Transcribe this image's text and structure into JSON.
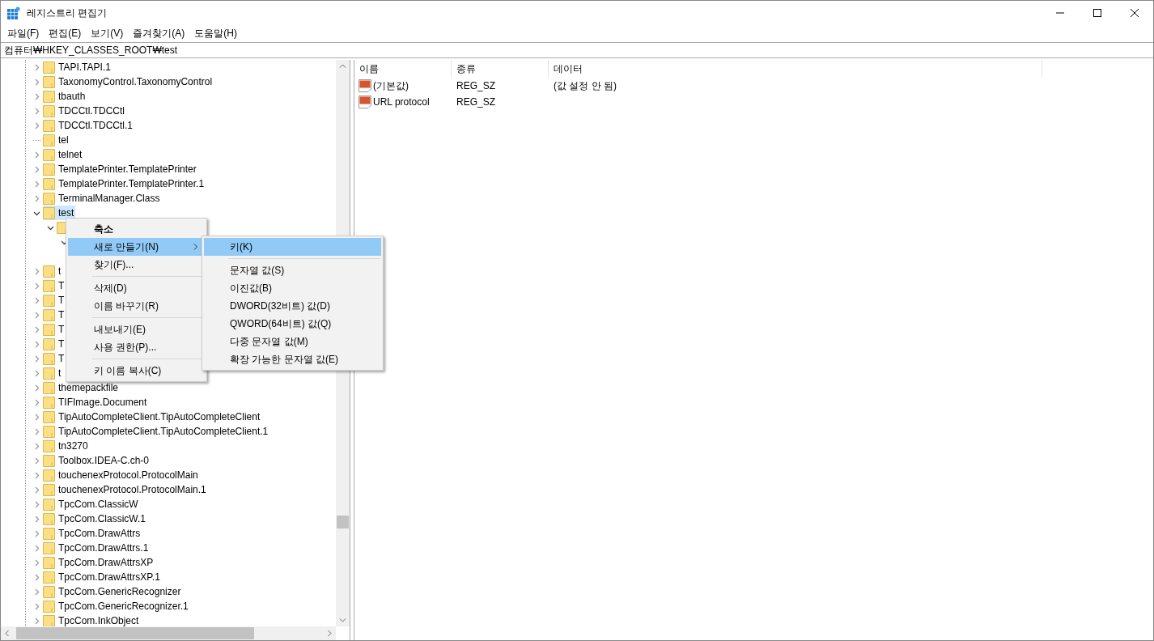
{
  "window": {
    "title": "레지스트리 편집기"
  },
  "menu_bar": [
    "파일(F)",
    "편집(E)",
    "보기(V)",
    "즐겨찾기(A)",
    "도움말(H)"
  ],
  "address": "컴퓨터₩HKEY_CLASSES_ROOT₩test",
  "tree": [
    {
      "label": "TAPI.TAPI.1",
      "kind": "key",
      "expanded": false,
      "selected": false
    },
    {
      "label": "TaxonomyControl.TaxonomyControl",
      "kind": "key",
      "expanded": false,
      "selected": false
    },
    {
      "label": "tbauth",
      "kind": "key",
      "expanded": false,
      "selected": false
    },
    {
      "label": "TDCCtl.TDCCtl",
      "kind": "key",
      "expanded": false,
      "selected": false
    },
    {
      "label": "TDCCtl.TDCCtl.1",
      "kind": "key",
      "expanded": false,
      "selected": false
    },
    {
      "label": "tel",
      "kind": "leaf",
      "selected": false
    },
    {
      "label": "telnet",
      "kind": "key",
      "expanded": false,
      "selected": false
    },
    {
      "label": "TemplatePrinter.TemplatePrinter",
      "kind": "key",
      "expanded": false,
      "selected": false
    },
    {
      "label": "TemplatePrinter.TemplatePrinter.1",
      "kind": "key",
      "expanded": false,
      "selected": false
    },
    {
      "label": "TerminalManager.Class",
      "kind": "key",
      "expanded": false,
      "selected": false
    },
    {
      "label": "test",
      "kind": "key",
      "expanded": true,
      "selected": true,
      "children": [
        {
          "kind": "key",
          "expanded": true,
          "selected": false,
          "children": [
            {
              "expanded": true
            }
          ]
        }
      ]
    },
    {
      "label": "t",
      "kind": "key",
      "expanded": false,
      "selected": false
    },
    {
      "label": "T",
      "kind": "key",
      "expanded": false,
      "selected": false
    },
    {
      "label": "T",
      "kind": "key",
      "expanded": false,
      "selected": false
    },
    {
      "label": "T",
      "kind": "key",
      "expanded": false,
      "selected": false
    },
    {
      "label": "T",
      "kind": "key",
      "expanded": false,
      "selected": false
    },
    {
      "label": "T",
      "kind": "key",
      "expanded": false,
      "selected": false
    },
    {
      "label": "T",
      "kind": "key",
      "expanded": false,
      "selected": false
    },
    {
      "label": "t",
      "kind": "key",
      "expanded": false,
      "selected": false
    },
    {
      "label": "themepackfile",
      "kind": "key",
      "expanded": false,
      "selected": false
    },
    {
      "label": "TIFImage.Document",
      "kind": "key",
      "expanded": false,
      "selected": false
    },
    {
      "label": "TipAutoCompleteClient.TipAutoCompleteClient",
      "kind": "key",
      "expanded": false,
      "selected": false
    },
    {
      "label": "TipAutoCompleteClient.TipAutoCompleteClient.1",
      "kind": "key",
      "expanded": false,
      "selected": false
    },
    {
      "label": "tn3270",
      "kind": "key",
      "expanded": false,
      "selected": false
    },
    {
      "label": "Toolbox.IDEA-C.ch-0",
      "kind": "key",
      "expanded": false,
      "selected": false
    },
    {
      "label": "touchenexProtocol.ProtocolMain",
      "kind": "key",
      "expanded": false,
      "selected": false
    },
    {
      "label": "touchenexProtocol.ProtocolMain.1",
      "kind": "key",
      "expanded": false,
      "selected": false
    },
    {
      "label": "TpcCom.ClassicW",
      "kind": "key",
      "expanded": false,
      "selected": false
    },
    {
      "label": "TpcCom.ClassicW.1",
      "kind": "key",
      "expanded": false,
      "selected": false
    },
    {
      "label": "TpcCom.DrawAttrs",
      "kind": "key",
      "expanded": false,
      "selected": false
    },
    {
      "label": "TpcCom.DrawAttrs.1",
      "kind": "key",
      "expanded": false,
      "selected": false
    },
    {
      "label": "TpcCom.DrawAttrsXP",
      "kind": "key",
      "expanded": false,
      "selected": false
    },
    {
      "label": "TpcCom.DrawAttrsXP.1",
      "kind": "key",
      "expanded": false,
      "selected": false
    },
    {
      "label": "TpcCom.GenericRecognizer",
      "kind": "key",
      "expanded": false,
      "selected": false
    },
    {
      "label": "TpcCom.GenericRecognizer.1",
      "kind": "key",
      "expanded": false,
      "selected": false
    },
    {
      "label": "TpcCom.InkObject",
      "kind": "key",
      "expanded": false,
      "selected": false
    }
  ],
  "values_table": {
    "columns": [
      "이름",
      "종류",
      "데이터"
    ],
    "rows": [
      {
        "name": "(기본값)",
        "type": "REG_SZ",
        "data": "(값 설정 안 됨)"
      },
      {
        "name": "URL protocol",
        "type": "REG_SZ"
      }
    ]
  },
  "context_menu": {
    "items": [
      {
        "kind": "item",
        "label": "축소",
        "bold": true,
        "selected": false,
        "submenu": false
      },
      {
        "kind": "item",
        "label": "새로 만들기(N)",
        "bold": false,
        "selected": true,
        "submenu": true
      },
      {
        "kind": "item",
        "label": "찾기(F)...",
        "bold": false,
        "selected": false,
        "submenu": false
      },
      {
        "kind": "separator"
      },
      {
        "kind": "item",
        "label": "삭제(D)",
        "bold": false,
        "selected": false,
        "submenu": false
      },
      {
        "kind": "item",
        "label": "이름 바꾸기(R)",
        "bold": false,
        "selected": false,
        "submenu": false
      },
      {
        "kind": "separator"
      },
      {
        "kind": "item",
        "label": "내보내기(E)",
        "bold": false,
        "selected": false,
        "submenu": false
      },
      {
        "kind": "item",
        "label": "사용 권한(P)...",
        "bold": false,
        "selected": false,
        "submenu": false
      },
      {
        "kind": "separator"
      },
      {
        "kind": "item",
        "label": "키 이름 복사(C)",
        "bold": false,
        "selected": false,
        "submenu": false
      }
    ]
  },
  "submenu": {
    "items": [
      {
        "kind": "item",
        "label": "키(K)",
        "selected": true
      },
      {
        "kind": "separator"
      },
      {
        "kind": "item",
        "label": "문자열 값(S)",
        "selected": false
      },
      {
        "kind": "item",
        "label": "이진값(B)",
        "selected": false
      },
      {
        "kind": "item",
        "label": "DWORD(32비트) 값(D)",
        "selected": false
      },
      {
        "kind": "item",
        "label": "QWORD(64비트) 값(Q)",
        "selected": false
      },
      {
        "kind": "item",
        "label": "다중 문자열 값(M)",
        "selected": false
      },
      {
        "kind": "item",
        "label": "확장 가능한 문자열 값(E)",
        "selected": false
      }
    ]
  }
}
